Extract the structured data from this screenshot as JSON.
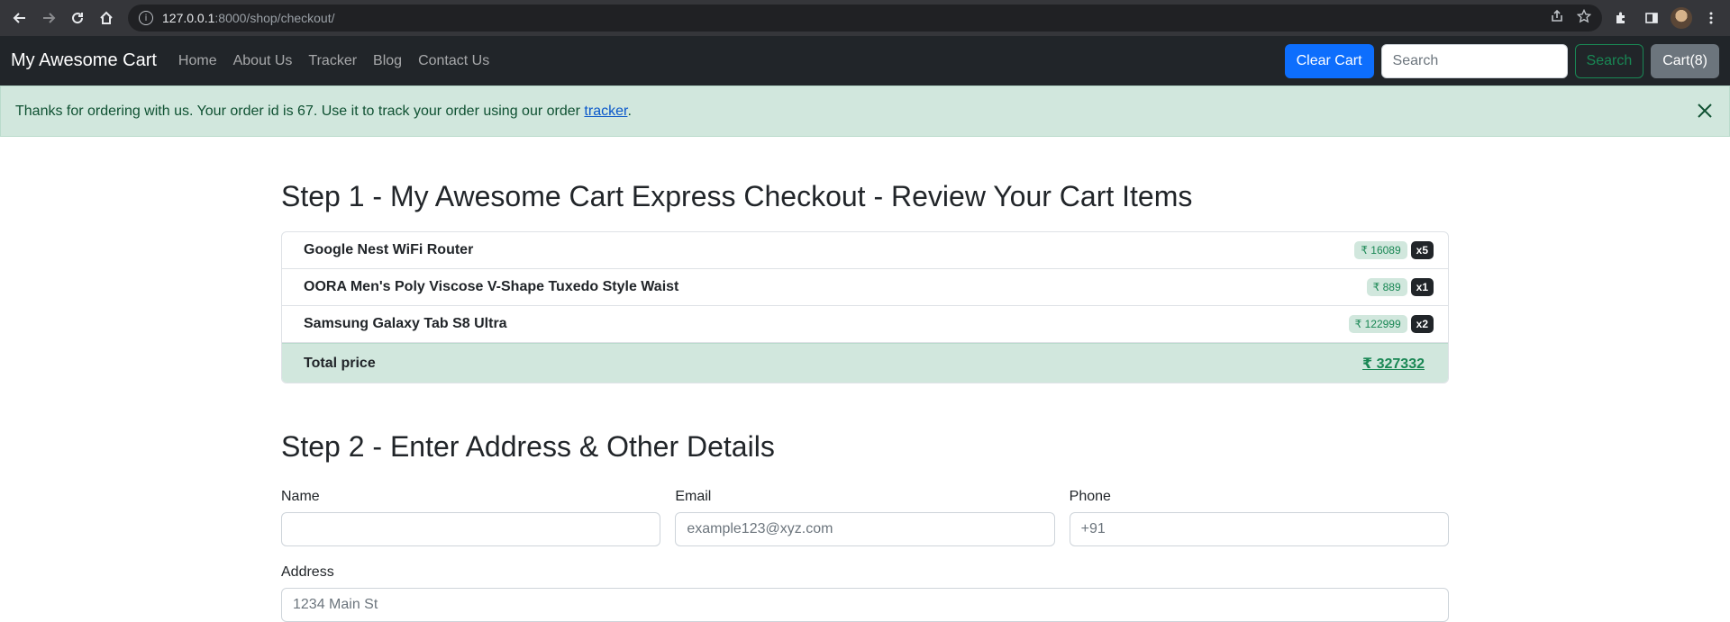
{
  "browser": {
    "url_host": "127.0.0.1",
    "url_rest": ":8000/shop/checkout/"
  },
  "navbar": {
    "brand": "My Awesome Cart",
    "links": [
      "Home",
      "About Us",
      "Tracker",
      "Blog",
      "Contact Us"
    ],
    "clear_cart": "Clear Cart",
    "search_placeholder": "Search",
    "search_button": "Search",
    "cart_button": "Cart(8)"
  },
  "alert": {
    "text_before": "Thanks for ordering with us. Your order id is 67. Use it to track your order using our order ",
    "link": "tracker",
    "text_after": "."
  },
  "step1": {
    "title": "Step 1 - My Awesome Cart Express Checkout - Review Your Cart Items",
    "items": [
      {
        "name": "Google Nest WiFi Router",
        "price": "₹ 16089",
        "qty": "x5"
      },
      {
        "name": "OORA Men's Poly Viscose V-Shape Tuxedo Style Waist",
        "price": "₹ 889",
        "qty": "x1"
      },
      {
        "name": "Samsung Galaxy Tab S8 Ultra",
        "price": "₹ 122999",
        "qty": "x2"
      }
    ],
    "total_label": "Total price",
    "total_value": "₹ 327332"
  },
  "step2": {
    "title": "Step 2 - Enter Address & Other Details",
    "name_label": "Name",
    "name_placeholder": "",
    "email_label": "Email",
    "email_placeholder": "example123@xyz.com",
    "phone_label": "Phone",
    "phone_placeholder": "+91",
    "address_label": "Address",
    "address_placeholder": "1234 Main St"
  },
  "colors": {
    "navbar_bg": "#212529",
    "primary": "#0d6efd",
    "success": "#198754",
    "alert_bg": "#d1e7dd"
  }
}
